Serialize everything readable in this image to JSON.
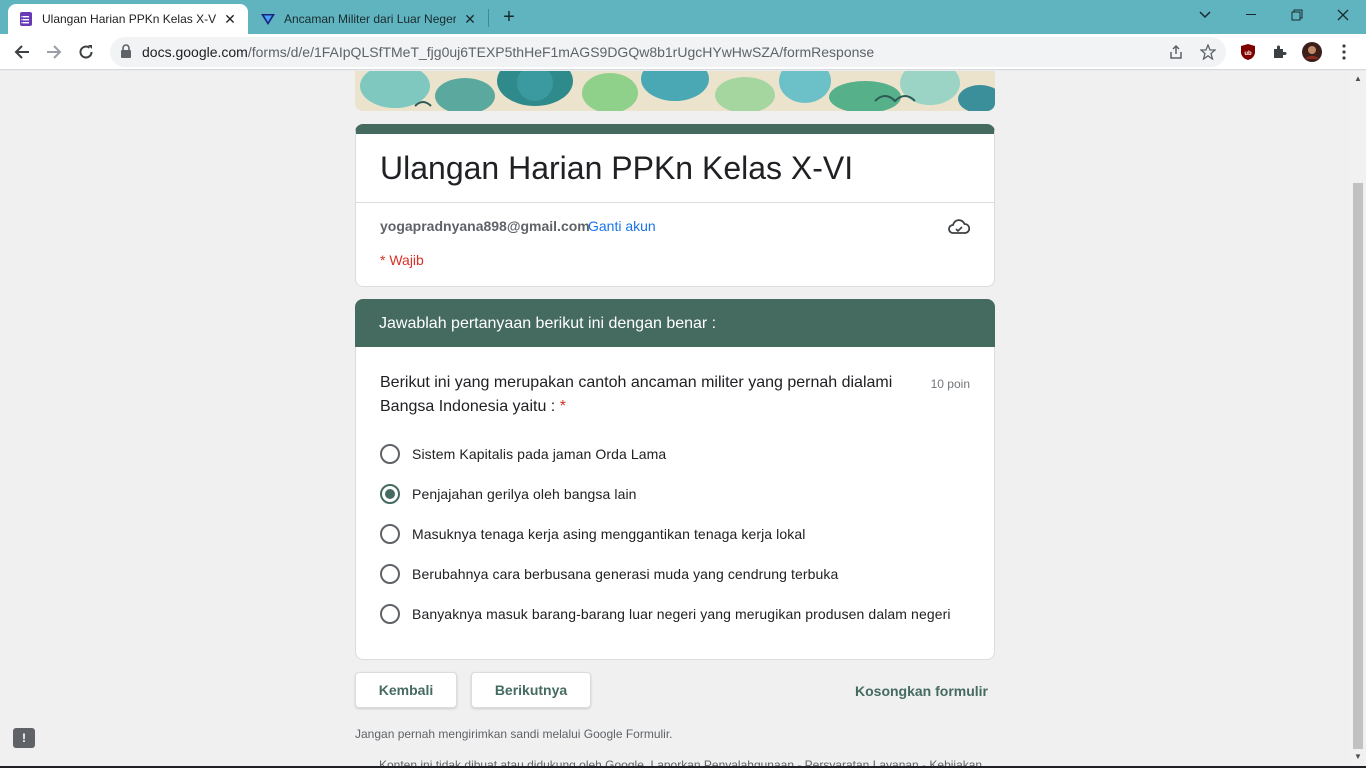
{
  "browser": {
    "tabs": [
      {
        "title": "Ulangan Harian PPKn Kelas X-VI",
        "active": true,
        "icon": "google-forms-icon"
      },
      {
        "title": "Ancaman Militer dari Luar Negeri",
        "active": false,
        "icon": "vectors-icon"
      }
    ],
    "url_host": "docs.google.com",
    "url_path": "/forms/d/e/1FAIpQLSfTMeT_fjg0uj6TEXP5thHeF1mAGS9DGQw8b1rUgcHYwHwSZA/formResponse",
    "accent_color": "#5fb4c0"
  },
  "form": {
    "title": "Ulangan Harian PPKn Kelas X-VI",
    "email": "yogapradnyana898@gmail.com",
    "switch_account": "Ganti akun",
    "required_note": "* Wajib",
    "theme_color": "#456b60",
    "section_title": "Jawablah pertanyaan berikut ini dengan benar :",
    "question": {
      "text": "Berikut ini yang merupakan cantoh ancaman militer yang pernah dialami Bangsa Indonesia yaitu :",
      "required_mark": "*",
      "points": "10 poin",
      "options": [
        {
          "label": "Sistem Kapitalis pada jaman Orda Lama",
          "selected": false
        },
        {
          "label": "Penjajahan gerilya oleh bangsa lain",
          "selected": true
        },
        {
          "label": "Masuknya tenaga kerja asing menggantikan tenaga kerja lokal",
          "selected": false
        },
        {
          "label": "Berubahnya cara berbusana generasi muda yang cendrung terbuka",
          "selected": false
        },
        {
          "label": "Banyaknya masuk barang-barang luar negeri yang merugikan produsen dalam negeri",
          "selected": false
        }
      ]
    },
    "buttons": {
      "back": "Kembali",
      "next": "Berikutnya",
      "clear": "Kosongkan formulir"
    },
    "footer_note": "Jangan pernah mengirimkan sandi melalui Google Formulir.",
    "footer_disclaimer": "Konten ini tidak dibuat atau didukung oleh Google. Laporkan Penyalahgunaan - Persyaratan Layanan - Kebijakan"
  }
}
